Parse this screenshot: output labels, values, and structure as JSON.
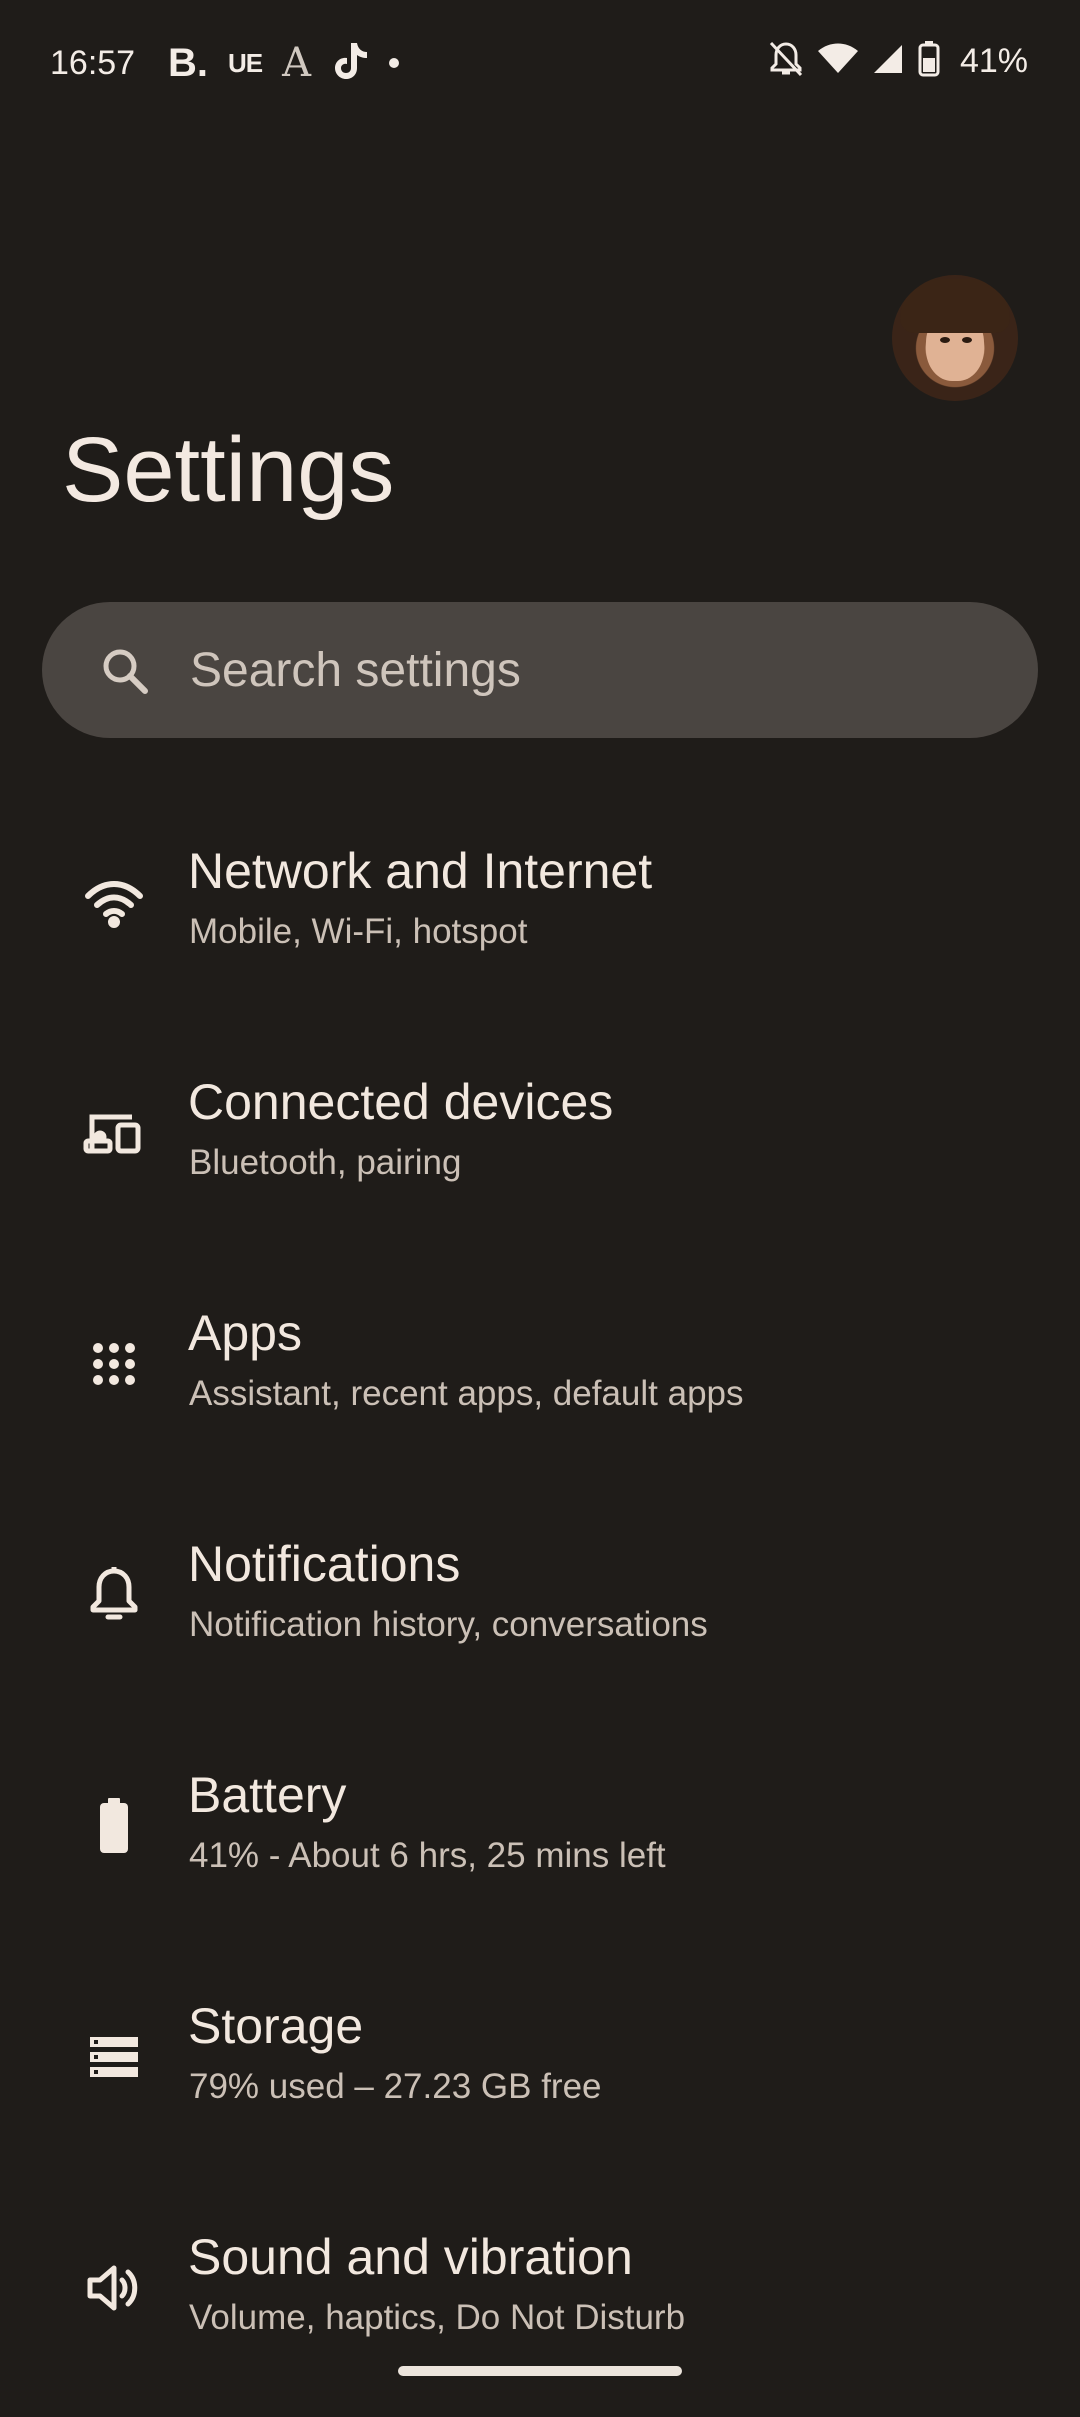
{
  "status_bar": {
    "time": "16:57",
    "left_icons": [
      "booking-icon",
      "ue-icon",
      "font-a-icon",
      "tiktok-icon",
      "more-dot-icon"
    ],
    "booking_label": "B.",
    "ue_label": "UE",
    "font_label": "A",
    "right_icons": [
      "mute-bell-icon",
      "wifi-icon",
      "signal-icon",
      "battery-icon"
    ],
    "battery_percent": "41%"
  },
  "header": {
    "title": "Settings"
  },
  "search": {
    "placeholder": "Search settings"
  },
  "settings_items": [
    {
      "icon": "wifi-icon",
      "title": "Network and Internet",
      "subtitle": "Mobile, Wi-Fi, hotspot"
    },
    {
      "icon": "connected-devices-icon",
      "title": "Connected devices",
      "subtitle": "Bluetooth, pairing"
    },
    {
      "icon": "apps-grid-icon",
      "title": "Apps",
      "subtitle": "Assistant, recent apps, default apps"
    },
    {
      "icon": "bell-icon",
      "title": "Notifications",
      "subtitle": "Notification history, conversations"
    },
    {
      "icon": "battery-icon",
      "title": "Battery",
      "subtitle": "41% - About 6 hrs, 25 mins left"
    },
    {
      "icon": "storage-icon",
      "title": "Storage",
      "subtitle": "79% used – 27.23 GB free"
    },
    {
      "icon": "speaker-icon",
      "title": "Sound and vibration",
      "subtitle": "Volume, haptics, Do Not Disturb"
    }
  ],
  "colors": {
    "background": "#1f1c19",
    "search_bg": "#4a4541",
    "text_primary": "#f2e8df",
    "text_secondary": "#cbc0b6"
  }
}
